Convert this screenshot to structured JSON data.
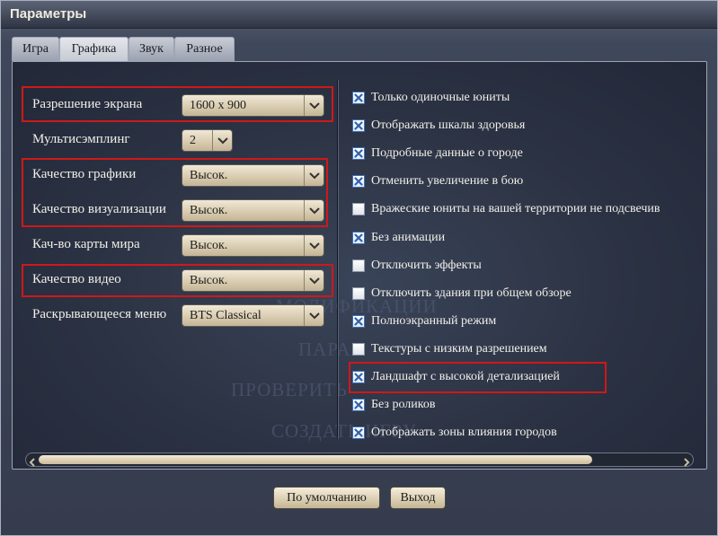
{
  "window": {
    "title": "Параметры"
  },
  "tabs": [
    {
      "label": "Игра",
      "active": false
    },
    {
      "label": "Графика",
      "active": true
    },
    {
      "label": "Звук",
      "active": false
    },
    {
      "label": "Разное",
      "active": false
    }
  ],
  "background_text": [
    "МОДИФИКАЦИИ",
    "ПАРА",
    "ПРОВЕРИТЬ",
    "СОЗДАТЬ ИГРУ"
  ],
  "settings": [
    {
      "label": "Разрешение экрана",
      "value": "1600 x 900",
      "highlighted": true
    },
    {
      "label": "Мультисэмплинг",
      "value": "2",
      "highlighted": false
    },
    {
      "label": "Качество графики",
      "value": "Высок.",
      "highlighted": true
    },
    {
      "label": "Качество визуализации",
      "value": "Высок.",
      "highlighted": true
    },
    {
      "label": "Кач-во карты мира",
      "value": "Высок.",
      "highlighted": false
    },
    {
      "label": "Качество видео",
      "value": "Высок.",
      "highlighted": true
    },
    {
      "label": "Раскрывающееся меню",
      "value": "BTS Classical",
      "highlighted": false
    }
  ],
  "checkboxes": [
    {
      "label": "Только одиночные юниты",
      "checked": true
    },
    {
      "label": "Отображать шкалы здоровья",
      "checked": true
    },
    {
      "label": "Подробные данные о городе",
      "checked": true
    },
    {
      "label": "Отменить увеличение в бою",
      "checked": true
    },
    {
      "label": "Вражеские юниты на вашей территории не подсвечив",
      "checked": false
    },
    {
      "label": "Без анимации",
      "checked": true
    },
    {
      "label": "Отключить эффекты",
      "checked": false
    },
    {
      "label": "Отключить здания при общем обзоре",
      "checked": false
    },
    {
      "label": "Полноэкранный режим",
      "checked": true
    },
    {
      "label": "Текстуры с низким разрешением",
      "checked": false
    },
    {
      "label": "Ландшафт с высокой детализацией",
      "checked": true,
      "highlighted": true
    },
    {
      "label": "Без роликов",
      "checked": true
    },
    {
      "label": "Отображать зоны влияния городов",
      "checked": true
    }
  ],
  "buttons": {
    "defaults": "По умолчанию",
    "exit": "Выход"
  },
  "colors": {
    "highlight": "#d01818",
    "check": "#2f64b0"
  }
}
